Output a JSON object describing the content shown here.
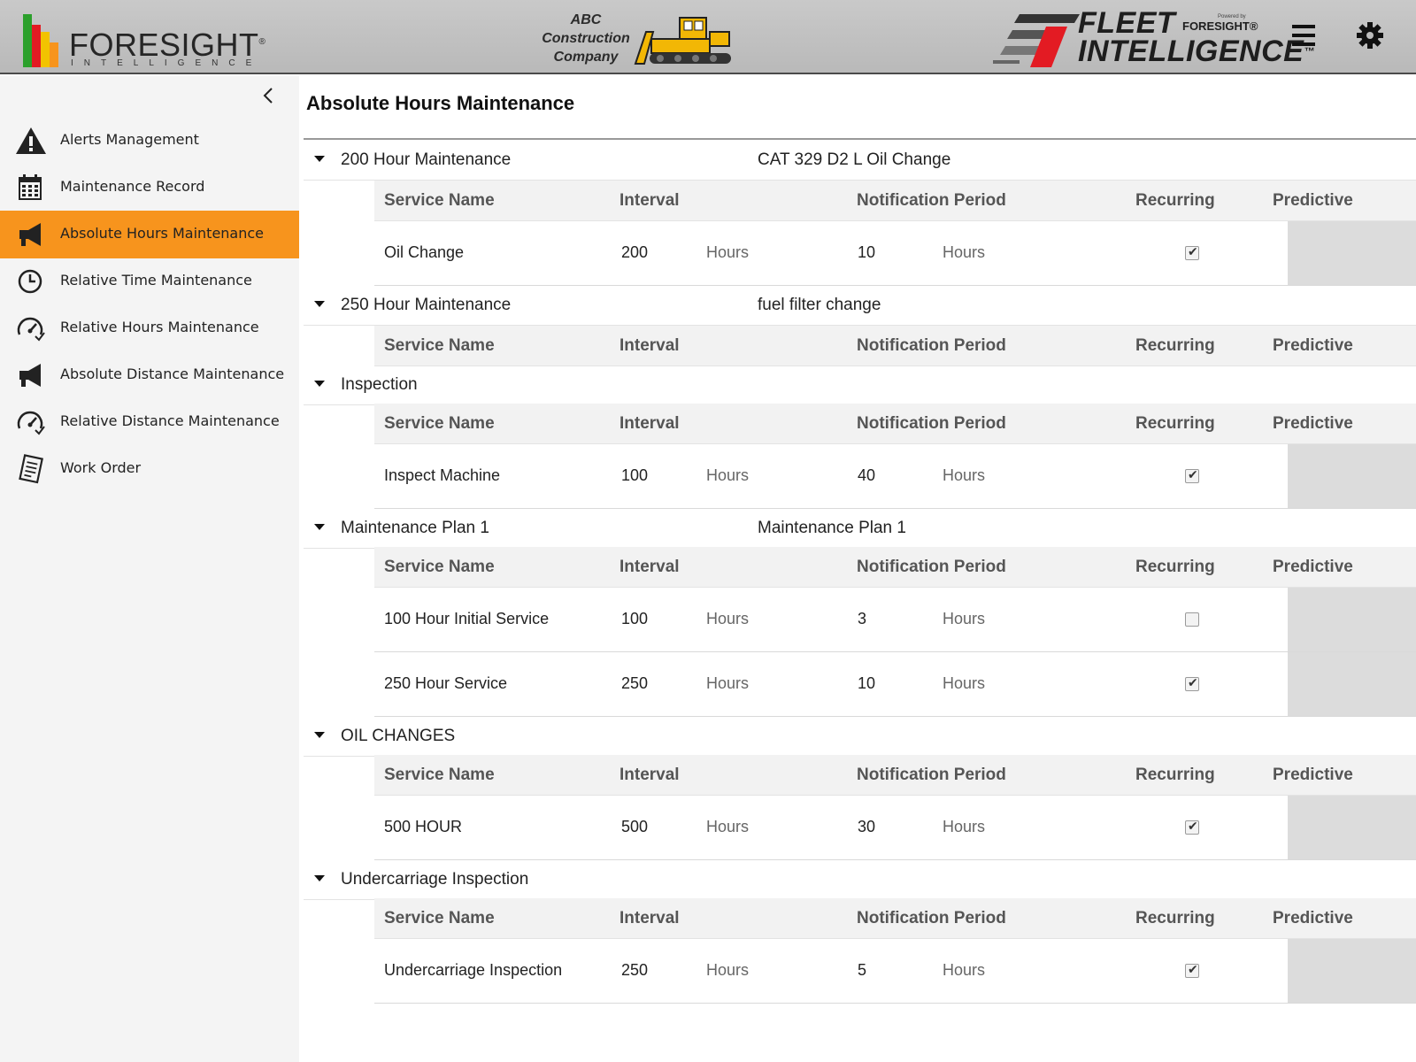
{
  "header": {
    "brand": "FORESIGHT",
    "brand_registered": "®",
    "brand_sub": "INTELLIGENCE",
    "company_line1": "ABC",
    "company_line2": "Construction",
    "company_line3": "Company",
    "fleet_line1": "FLEET",
    "fleet_line2": "INTELLIGENCE",
    "fleet_tm": "™",
    "powered_by": "Powered by",
    "powered_brand": "FORESIGHT®",
    "menu_icon": "hamburger-menu-icon",
    "settings_icon": "gear-icon"
  },
  "colors": {
    "accent": "#f7941d",
    "header_bg": "#bdbdbd",
    "sidebar_bg": "#f4f4f4",
    "predictive_bg": "#dcdcdc",
    "fleet_red": "#e31b23"
  },
  "sidebar": {
    "collapse_icon": "chevron-left-icon",
    "items": [
      {
        "label": "Alerts Management",
        "icon": "warning-icon",
        "active": false
      },
      {
        "label": "Maintenance Record",
        "icon": "calendar-icon",
        "active": false
      },
      {
        "label": "Absolute Hours Maintenance",
        "icon": "megaphone-icon",
        "active": true
      },
      {
        "label": "Relative Time Maintenance",
        "icon": "clock-icon",
        "active": false
      },
      {
        "label": "Relative Hours Maintenance",
        "icon": "speedometer-icon",
        "active": false
      },
      {
        "label": "Absolute Distance Maintenance",
        "icon": "megaphone-icon",
        "active": false
      },
      {
        "label": "Relative Distance Maintenance",
        "icon": "speedometer-icon",
        "active": false
      },
      {
        "label": "Work Order",
        "icon": "document-icon",
        "active": false
      }
    ]
  },
  "main": {
    "title": "Absolute Hours Maintenance",
    "columns": {
      "service_name": "Service Name",
      "interval": "Interval",
      "notification_period": "Notification Period",
      "recurring": "Recurring",
      "predictive": "Predictive"
    },
    "groups": [
      {
        "name": "200 Hour Maintenance",
        "description": "CAT 329 D2 L Oil Change",
        "rows": [
          {
            "service": "Oil Change",
            "interval": "200",
            "interval_unit": "Hours",
            "notify": "10",
            "notify_unit": "Hours",
            "recurring": true
          }
        ]
      },
      {
        "name": "250 Hour Maintenance",
        "description": "fuel filter change",
        "rows": []
      },
      {
        "name": "Inspection",
        "description": "",
        "rows": [
          {
            "service": "Inspect Machine",
            "interval": "100",
            "interval_unit": "Hours",
            "notify": "40",
            "notify_unit": "Hours",
            "recurring": true
          }
        ]
      },
      {
        "name": "Maintenance Plan 1",
        "description": "Maintenance Plan 1",
        "rows": [
          {
            "service": "100 Hour Initial Service",
            "interval": "100",
            "interval_unit": "Hours",
            "notify": "3",
            "notify_unit": "Hours",
            "recurring": false
          },
          {
            "service": "250 Hour Service",
            "interval": "250",
            "interval_unit": "Hours",
            "notify": "10",
            "notify_unit": "Hours",
            "recurring": true
          }
        ]
      },
      {
        "name": "OIL CHANGES",
        "description": "",
        "rows": [
          {
            "service": "500 HOUR",
            "interval": "500",
            "interval_unit": "Hours",
            "notify": "30",
            "notify_unit": "Hours",
            "recurring": true
          }
        ]
      },
      {
        "name": "Undercarriage Inspection",
        "description": "",
        "rows": [
          {
            "service": "Undercarriage Inspection",
            "interval": "250",
            "interval_unit": "Hours",
            "notify": "5",
            "notify_unit": "Hours",
            "recurring": true
          }
        ]
      }
    ]
  }
}
